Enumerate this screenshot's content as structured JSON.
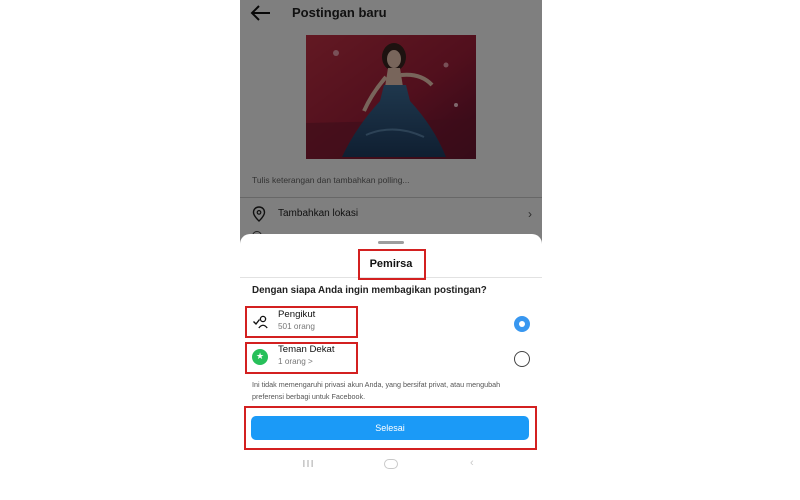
{
  "screen": {
    "title": "Postingan baru",
    "caption_placeholder": "Tulis keterangan dan tambahkan polling...",
    "location_label": "Tambahkan lokasi",
    "location_chevron": "›"
  },
  "sheet": {
    "title": "Pemirsa",
    "question": "Dengan siapa Anda ingin membagikan postingan?",
    "options": [
      {
        "title": "Pengikut",
        "subtitle": "501 orang",
        "icon": "followers-icon",
        "selected": true
      },
      {
        "title": "Teman Dekat",
        "subtitle": "1 orang >",
        "icon": "close-friends-star-icon",
        "selected": false
      }
    ],
    "note": "Ini tidak memengaruhi privasi akun Anda, yang bersifat privat, atau mengubah preferensi berbagi untuk Facebook.",
    "done_label": "Selesai"
  },
  "navbar": {
    "back_glyph": "‹"
  },
  "colors": {
    "accent_blue": "#1b9af7",
    "radio_blue": "#3897f0",
    "close_friends_green": "#27c05a",
    "annotation_red": "#d32020"
  }
}
